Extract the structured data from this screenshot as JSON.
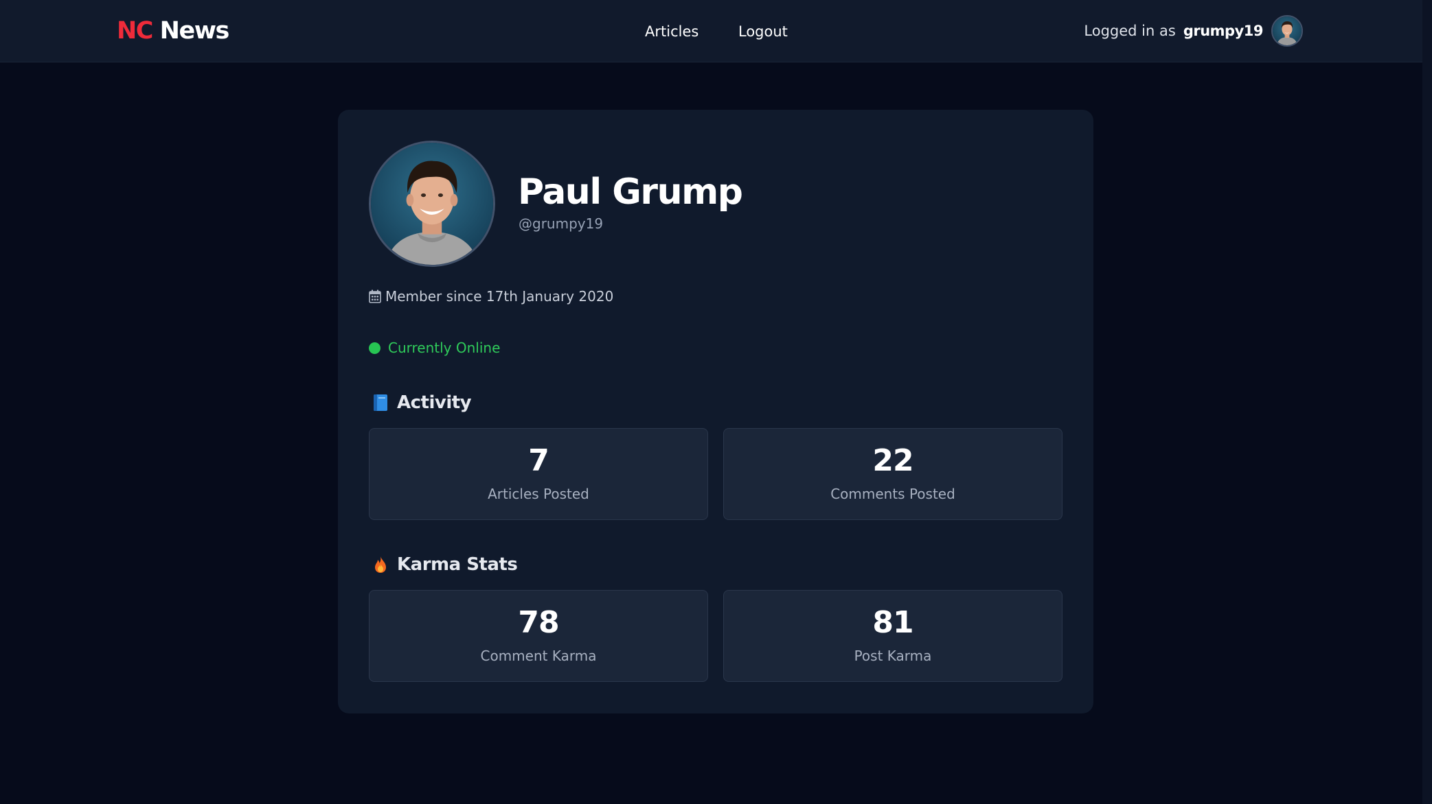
{
  "header": {
    "logo_accent": "NC",
    "logo_rest": "News",
    "nav": [
      {
        "label": "Articles"
      },
      {
        "label": "Logout"
      }
    ],
    "logged_in_label": "Logged in as",
    "username": "grumpy19",
    "avatar_icon": "user-avatar"
  },
  "profile": {
    "full_name": "Paul Grump",
    "handle": "@grumpy19",
    "member_since": "Member since 17th January 2020",
    "member_icon": "calendar-icon",
    "status": "Currently Online",
    "status_color": "#27c453"
  },
  "activity": {
    "title": "Activity",
    "icon": "blue-book-icon",
    "stats": [
      {
        "value": "7",
        "label": "Articles Posted"
      },
      {
        "value": "22",
        "label": "Comments Posted"
      }
    ]
  },
  "karma": {
    "title": "Karma Stats",
    "icon": "fire-icon",
    "stats": [
      {
        "value": "78",
        "label": "Comment Karma"
      },
      {
        "value": "81",
        "label": "Post Karma"
      }
    ]
  },
  "colors": {
    "background": "#060b1b",
    "header": "#111a2c",
    "card": "#101a2c",
    "stat_box": "#1b2639",
    "brand_accent": "#ef2b3a"
  }
}
